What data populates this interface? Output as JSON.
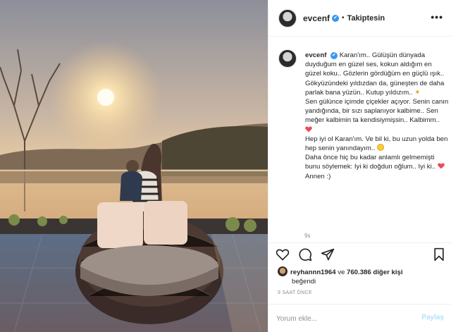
{
  "post": {
    "username": "evcenf",
    "verified_mark": "✔",
    "dot": "•",
    "follow_status": "Takiptesin",
    "more_label": "•••",
    "photo_description_icon": "photo-of-woman-and-child-on-balcony-sunset",
    "caption_user": "evcenf",
    "caption_lines": [
      "Karan'ım.. Gülüşün dünyada duyduğum en güzel ses, kokun aldığım en güzel koku.. Gözlerin gördüğüm en güçlü ışık..",
      "Gökyüzündeki yıldızdan da, güneşten de daha parlak bana yüzün.. Kutup yıldızım..",
      "Sen gülünce içimde çiçekler açıyor. Senin canın yandığında, bir sızı saplanıyor kalbime.. Sen meğer kalbimin ta kendisiymişsin.. Kalbimm..",
      "Hep iyi ol Karan'ım. Ve bil ki, bu uzun yolda ben hep senin yanındayım..",
      "Daha önce hiç bu kadar anlamlı gelmemişti bunu söylemek: Iyi ki doğdun oğlum.. Iyi ki..",
      "Annen :)"
    ],
    "caption_time": "9s",
    "likes": {
      "first_liker": "reyhannn1964",
      "connector": "ve",
      "others": "760.386 diğer kişi",
      "liked_text": "beğendi"
    },
    "time_ago": "9 SAAT ÖNCE",
    "comment_placeholder": "Yorum ekle...",
    "post_button": "Paylaş",
    "icons": {
      "like": "heart-outline-icon",
      "comment": "comment-bubble-icon",
      "share": "paper-plane-icon",
      "save": "bookmark-icon"
    },
    "colors": {
      "accent_blue": "#3897f0",
      "post_button_disabled": "#b2dffc",
      "emoji_heart": "#ed4956"
    }
  }
}
